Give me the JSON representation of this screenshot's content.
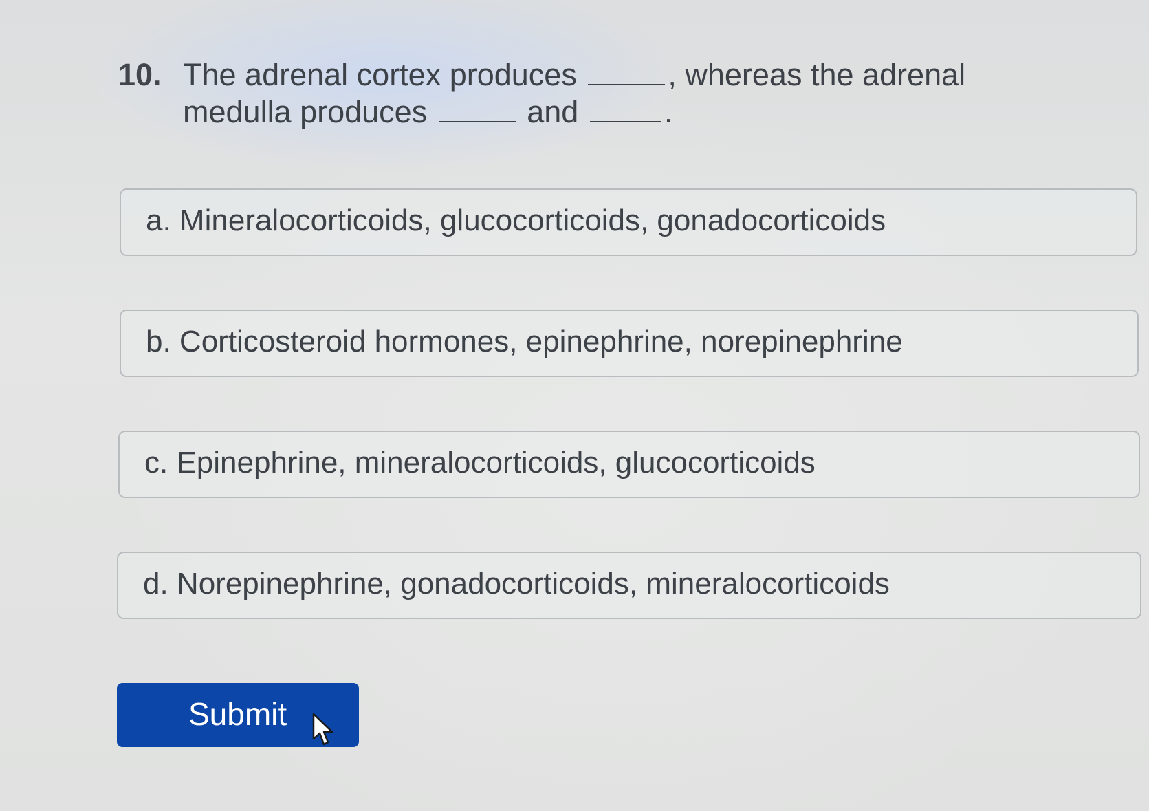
{
  "question": {
    "number": "10.",
    "part1": "The adrenal cortex produces",
    "part2": ", whereas the adrenal medulla produces",
    "part3": "and",
    "part4": "."
  },
  "options": [
    {
      "label": "a. Mineralocorticoids, glucocorticoids, gonadocorticoids"
    },
    {
      "label": "b. Corticosteroid hormones, epinephrine, norepinephrine"
    },
    {
      "label": "c. Epinephrine, mineralocorticoids, glucocorticoids"
    },
    {
      "label": "d. Norepinephrine, gonadocorticoids, mineralocorticoids"
    }
  ],
  "submit": {
    "label": "Submit"
  },
  "icons": {
    "cursor": "mouse-pointer-icon"
  },
  "colors": {
    "submit_bg": "#0b46a8",
    "option_border": "#b9bcbf",
    "text": "#3d4248"
  }
}
